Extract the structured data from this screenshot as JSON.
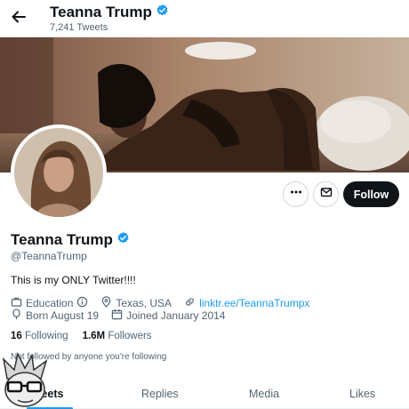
{
  "header": {
    "name": "Teanna Trump",
    "tweet_count": "7,241 Tweets"
  },
  "profile": {
    "display_name": "Teanna Trump",
    "handle": "@TeannaTrump",
    "bio": "This is my ONLY Twitter!!!!",
    "category": "Education",
    "location": "Texas, USA",
    "website": "linktr.ee/TeannaTrumpx",
    "birthday": "Born August 19",
    "joined": "Joined January 2014",
    "following_count": "16",
    "following_label": "Following",
    "followers_count": "1.6M",
    "followers_label": "Followers",
    "not_followed_text": "Not followed by anyone you're following"
  },
  "actions": {
    "follow_label": "Follow"
  },
  "tabs": [
    {
      "label": "Tweets",
      "active": true
    },
    {
      "label": "Replies",
      "active": false
    },
    {
      "label": "Media",
      "active": false
    },
    {
      "label": "Likes",
      "active": false
    }
  ],
  "icons": {
    "back": "arrow-left-icon",
    "verified": "verified-badge-icon",
    "more": "more-horizontal-icon",
    "message": "envelope-icon",
    "category": "briefcase-icon",
    "info": "info-circle-icon",
    "location": "location-pin-icon",
    "link": "link-icon",
    "birthday": "balloon-icon",
    "calendar": "calendar-icon"
  },
  "colors": {
    "accent": "#1d9bf0",
    "text": "#0f1419",
    "secondary_text": "#536471",
    "follow_button": "#0f1419"
  }
}
